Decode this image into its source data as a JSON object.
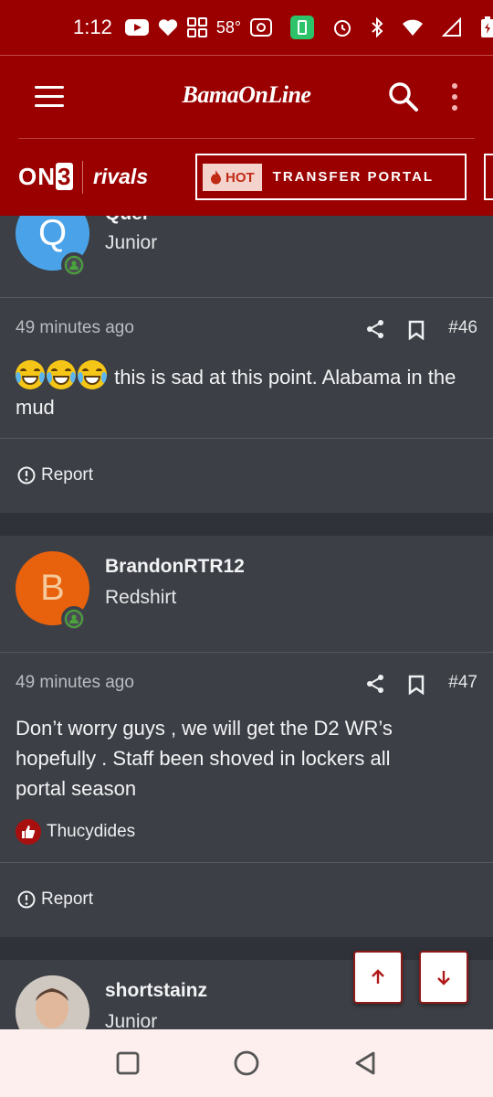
{
  "status_bar": {
    "time": "1:12",
    "temperature": "58°",
    "icons": [
      "youtube-icon",
      "heart-icon",
      "apps-icon",
      "nfc-icon",
      "battery-saver-icon",
      "alarm-icon",
      "bluetooth-icon",
      "wifi-icon",
      "signal-icon",
      "battery-icon"
    ]
  },
  "header": {
    "logo": "BamaOnLine",
    "on3_logo": "ON3",
    "rivals_logo": "rivals",
    "hot_badge": "HOT",
    "portal_button": "TRANSFER PORTAL"
  },
  "posts": [
    {
      "username": "Quel",
      "rank": "Junior",
      "avatar_letter": "Q",
      "avatar_color": "#4aa3e8"
    },
    {
      "time": "49 minutes ago",
      "post_number": "#46",
      "text": "this is sad at this point. Alabama in the mud",
      "emojis": [
        "joy-emoji",
        "joy-emoji",
        "joy-emoji"
      ],
      "report_label": "Report"
    },
    {
      "username": "BrandonRTR12",
      "rank": "Redshirt",
      "avatar_letter": "B",
      "avatar_color": "#e8620e",
      "time": "49 minutes ago",
      "post_number": "#47",
      "text": "Don’t worry guys , we will get the D2 WR’s hopefully . Staff been shoved in lockers all portal season",
      "liked_by": "Thucydides",
      "report_label": "Report"
    },
    {
      "username": "shortstainz",
      "rank": "Junior"
    }
  ],
  "colors": {
    "brand_red": "#9b0000",
    "card_bg": "#3c3f45",
    "page_bg": "#2f3238",
    "online_green": "#4aa33b"
  }
}
